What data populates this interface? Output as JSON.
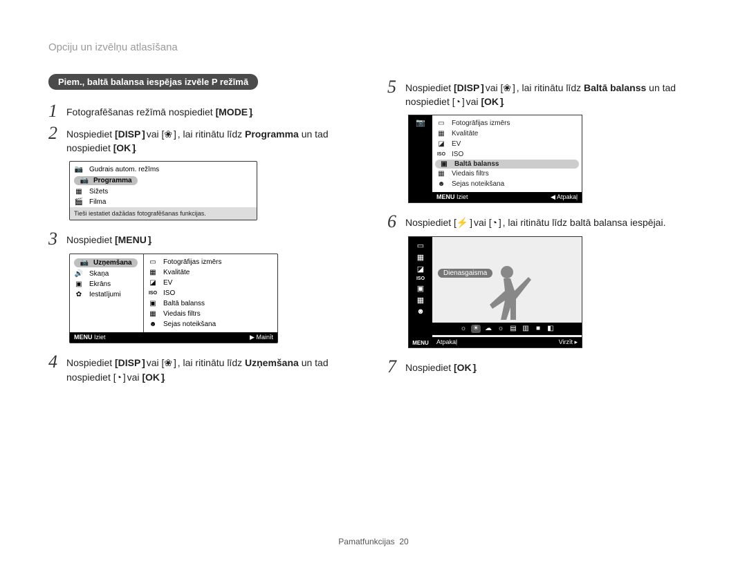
{
  "header": {
    "section_title": "Opciju un izvēlņu atlasīšana"
  },
  "pill": {
    "text": "Piem., baltā balansa iespējas izvēle P režīmā"
  },
  "buttons": {
    "mode": "MODE",
    "disp": "DISP",
    "menu": "MENU",
    "ok": "OK",
    "flower": "❀",
    "timer": "◔",
    "flash": "⚡"
  },
  "steps": {
    "s1": {
      "num": "1",
      "text": "Fotografēšanas režīmā nospiediet "
    },
    "s2": {
      "num": "2",
      "t1": "Nospiediet ",
      "t2": " vai ",
      "t3": ", lai ritinātu līdz ",
      "prog": "Programma",
      "t4": " un tad nospiediet "
    },
    "s3": {
      "num": "3",
      "text": "Nospiediet "
    },
    "s4": {
      "num": "4",
      "t1": "Nospiediet ",
      "t2": " vai ",
      "t3": ", lai ritinātu līdz ",
      "uzn": "Uzņemšana",
      "t4": " un tad nospiediet ",
      "t5": " vai "
    },
    "s5": {
      "num": "5",
      "t1": "Nospiediet ",
      "t2": " vai ",
      "t3": ", lai ritinātu līdz ",
      "bb": "Baltā balanss",
      "t4": " un tad nospiediet ",
      "t5": " vai "
    },
    "s6": {
      "num": "6",
      "t1": "Nospiediet ",
      "t2": " vai ",
      "t3": ", lai ritinātu līdz baltā balansa iespējai."
    },
    "s7": {
      "num": "7",
      "text": "Nospiediet "
    }
  },
  "lcd1": {
    "items": [
      {
        "icon": "📷",
        "label": "Gudrais autom. režīms"
      },
      {
        "icon": "📷",
        "label": "Programma",
        "selected": true
      },
      {
        "icon": "▦",
        "label": "Sižets"
      },
      {
        "icon": "🎬",
        "label": "Filma"
      }
    ],
    "desc": "Tieši iestatiet dažādas fotografēšanas funkcijas."
  },
  "lcd2": {
    "left": [
      {
        "icon": "📷",
        "label": "Uzņemšana",
        "selected": true
      },
      {
        "icon": "🔊",
        "label": "Skaņa"
      },
      {
        "icon": "▣",
        "label": "Ekrāns"
      },
      {
        "icon": "✿",
        "label": "Iestatījumi"
      }
    ],
    "right": [
      {
        "icon": "▭",
        "label": "Fotogrāfijas izmērs"
      },
      {
        "icon": "▦",
        "label": "Kvalitāte"
      },
      {
        "icon": "◪",
        "label": "EV"
      },
      {
        "icon": "ISO",
        "label": "ISO"
      },
      {
        "icon": "▣",
        "label": "Baltā balanss"
      },
      {
        "icon": "▦",
        "label": "Viedais filtrs"
      },
      {
        "icon": "☻",
        "label": "Sejas noteikšana"
      }
    ],
    "bar": {
      "left": "Iziet",
      "left_btn": "MENU",
      "right": "Mainīt",
      "right_sym": "▶"
    }
  },
  "lcd3": {
    "strip": [
      "📷"
    ],
    "list": [
      {
        "icon": "▭",
        "label": "Fotogrāfijas izmērs"
      },
      {
        "icon": "▦",
        "label": "Kvalitāte"
      },
      {
        "icon": "◪",
        "label": "EV"
      },
      {
        "icon": "ISO",
        "label": "ISO"
      },
      {
        "icon": "▣",
        "label": "Baltā balanss",
        "selected": true
      },
      {
        "icon": "▦",
        "label": "Viedais filtrs"
      },
      {
        "icon": "☻",
        "label": "Sejas noteikšana"
      }
    ],
    "bar": {
      "left": "Iziet",
      "left_btn": "MENU",
      "right": "Atpakaļ",
      "right_sym": "◀"
    }
  },
  "lcd4": {
    "strip_icons": [
      "▭",
      "▦",
      "◪",
      "ISO",
      "▣",
      "▦",
      "☻"
    ],
    "strip_menu": "MENU",
    "preview_label": "Dienasgaisma",
    "film": [
      "☼",
      "☀",
      "☁",
      "☼",
      "▤",
      "▥",
      "■",
      "◧"
    ],
    "film_sel_index": 1,
    "bar": {
      "left": "Atpakaļ",
      "right": "Virzīt",
      "right_sym": "▸"
    }
  },
  "footer": {
    "section": "Pamatfunkcijas",
    "page": "20"
  }
}
